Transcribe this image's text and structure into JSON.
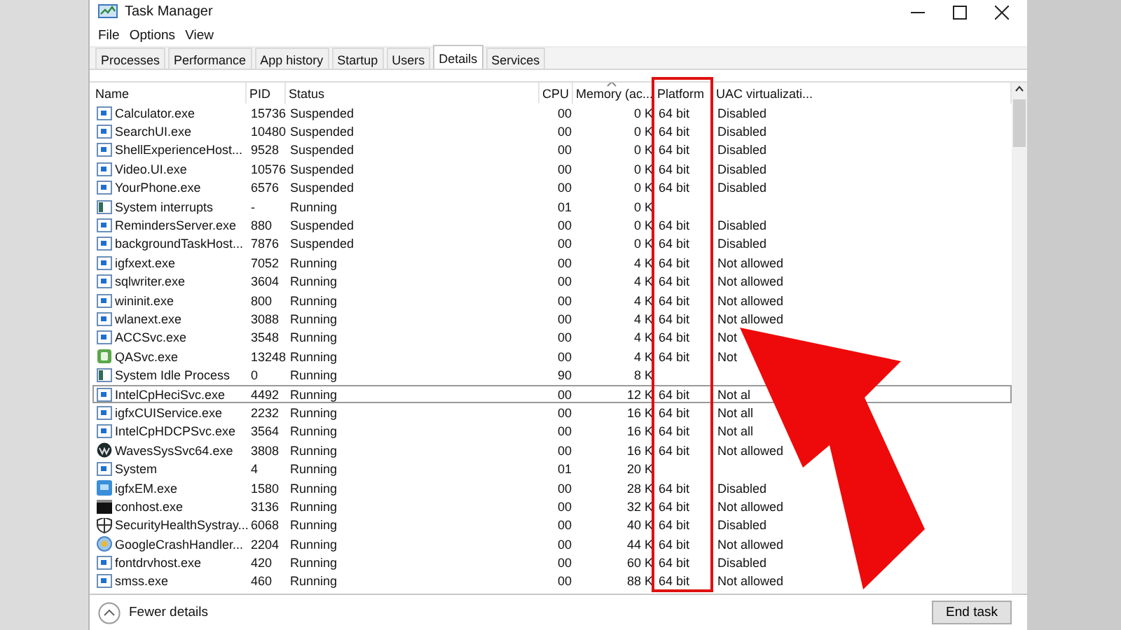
{
  "window": {
    "title": "Task Manager"
  },
  "menu": [
    "File",
    "Options",
    "View"
  ],
  "tabs": [
    {
      "label": "Processes",
      "selected": false
    },
    {
      "label": "Performance",
      "selected": false
    },
    {
      "label": "App history",
      "selected": false
    },
    {
      "label": "Startup",
      "selected": false
    },
    {
      "label": "Users",
      "selected": false
    },
    {
      "label": "Details",
      "selected": true
    },
    {
      "label": "Services",
      "selected": false
    }
  ],
  "table": {
    "columns": [
      {
        "label": "Name",
        "sorted": false
      },
      {
        "label": "PID",
        "sorted": false
      },
      {
        "label": "Status",
        "sorted": false
      },
      {
        "label": "CPU",
        "sorted": false
      },
      {
        "label": "Memory (ac...",
        "sorted": true
      },
      {
        "label": "Platform",
        "sorted": false
      },
      {
        "label": "UAC virtualizati...",
        "sorted": false
      }
    ],
    "rows": [
      {
        "kind": "app",
        "name": "Calculator.exe",
        "pid": "15736",
        "status": "Suspended",
        "cpu": "00",
        "memory": "0 K",
        "platform": "64 bit",
        "uac": "Disabled",
        "selected": false
      },
      {
        "kind": "app",
        "name": "SearchUI.exe",
        "pid": "10480",
        "status": "Suspended",
        "cpu": "00",
        "memory": "0 K",
        "platform": "64 bit",
        "uac": "Disabled",
        "selected": false
      },
      {
        "kind": "app",
        "name": "ShellExperienceHost...",
        "pid": "9528",
        "status": "Suspended",
        "cpu": "00",
        "memory": "0 K",
        "platform": "64 bit",
        "uac": "Disabled",
        "selected": false
      },
      {
        "kind": "app",
        "name": "Video.UI.exe",
        "pid": "10576",
        "status": "Suspended",
        "cpu": "00",
        "memory": "0 K",
        "platform": "64 bit",
        "uac": "Disabled",
        "selected": false
      },
      {
        "kind": "app",
        "name": "YourPhone.exe",
        "pid": "6576",
        "status": "Suspended",
        "cpu": "00",
        "memory": "0 K",
        "platform": "64 bit",
        "uac": "Disabled",
        "selected": false
      },
      {
        "kind": "system",
        "name": "System interrupts",
        "pid": "-",
        "status": "Running",
        "cpu": "01",
        "memory": "0 K",
        "selected": false
      },
      {
        "kind": "app",
        "name": "RemindersServer.exe",
        "pid": "880",
        "status": "Suspended",
        "cpu": "00",
        "memory": "0 K",
        "platform": "64 bit",
        "uac": "Disabled",
        "selected": false
      },
      {
        "kind": "app",
        "name": "backgroundTaskHost...",
        "pid": "7876",
        "status": "Suspended",
        "cpu": "00",
        "memory": "0 K",
        "platform": "64 bit",
        "uac": "Disabled",
        "selected": false
      },
      {
        "kind": "app",
        "name": "igfxext.exe",
        "pid": "7052",
        "status": "Running",
        "cpu": "00",
        "memory": "4 K",
        "platform": "64 bit",
        "uac": "Not allowed",
        "selected": false
      },
      {
        "kind": "app",
        "name": "sqlwriter.exe",
        "pid": "3604",
        "status": "Running",
        "cpu": "00",
        "memory": "4 K",
        "platform": "64 bit",
        "uac": "Not allowed",
        "selected": false
      },
      {
        "kind": "app",
        "name": "wininit.exe",
        "pid": "800",
        "status": "Running",
        "cpu": "00",
        "memory": "4 K",
        "platform": "64 bit",
        "uac": "Not allowed",
        "selected": false
      },
      {
        "kind": "app",
        "name": "wlanext.exe",
        "pid": "3088",
        "status": "Running",
        "cpu": "00",
        "memory": "4 K",
        "platform": "64 bit",
        "uac": "Not allowed",
        "selected": false
      },
      {
        "kind": "app",
        "name": "ACCSvc.exe",
        "pid": "3548",
        "status": "Running",
        "cpu": "00",
        "memory": "4 K",
        "platform": "64 bit",
        "uac": "Not",
        "selected": false
      },
      {
        "kind": "qa",
        "name": "QASvc.exe",
        "pid": "13248",
        "status": "Running",
        "cpu": "00",
        "memory": "4 K",
        "platform": "64 bit",
        "uac": "Not",
        "selected": false
      },
      {
        "kind": "system",
        "name": "System Idle Process",
        "pid": "0",
        "status": "Running",
        "cpu": "90",
        "memory": "8 K",
        "selected": false
      },
      {
        "kind": "app",
        "name": "IntelCpHeciSvc.exe",
        "pid": "4492",
        "status": "Running",
        "cpu": "00",
        "memory": "12 K",
        "platform": "64 bit",
        "uac": "Not al",
        "selected": true
      },
      {
        "kind": "app",
        "name": "igfxCUIService.exe",
        "pid": "2232",
        "status": "Running",
        "cpu": "00",
        "memory": "16 K",
        "platform": "64 bit",
        "uac": "Not all",
        "selected": false
      },
      {
        "kind": "app",
        "name": "IntelCpHDCPSvc.exe",
        "pid": "3564",
        "status": "Running",
        "cpu": "00",
        "memory": "16 K",
        "platform": "64 bit",
        "uac": "Not all",
        "selected": false
      },
      {
        "kind": "waves",
        "name": "WavesSysSvc64.exe",
        "pid": "3808",
        "status": "Running",
        "cpu": "00",
        "memory": "16 K",
        "platform": "64 bit",
        "uac": "Not allowed",
        "selected": false
      },
      {
        "kind": "app",
        "name": "System",
        "pid": "4",
        "status": "Running",
        "cpu": "01",
        "memory": "20 K",
        "selected": false
      },
      {
        "kind": "graphics",
        "name": "igfxEM.exe",
        "pid": "1580",
        "status": "Running",
        "cpu": "00",
        "memory": "28 K",
        "platform": "64 bit",
        "uac": "Disabled",
        "selected": false
      },
      {
        "kind": "console",
        "name": "conhost.exe",
        "pid": "3136",
        "status": "Running",
        "cpu": "00",
        "memory": "32 K",
        "platform": "64 bit",
        "uac": "Not allowed",
        "selected": false
      },
      {
        "kind": "shield",
        "name": "SecurityHealthSystray...",
        "pid": "6068",
        "status": "Running",
        "cpu": "00",
        "memory": "40 K",
        "platform": "64 bit",
        "uac": "Disabled",
        "selected": false
      },
      {
        "kind": "crash",
        "name": "GoogleCrashHandler...",
        "pid": "2204",
        "status": "Running",
        "cpu": "00",
        "memory": "44 K",
        "platform": "64 bit",
        "uac": "Not allowed",
        "selected": false
      },
      {
        "kind": "app",
        "name": "fontdrvhost.exe",
        "pid": "420",
        "status": "Running",
        "cpu": "00",
        "memory": "60 K",
        "platform": "64 bit",
        "uac": "Disabled",
        "selected": false
      },
      {
        "kind": "app",
        "name": "smss.exe",
        "pid": "460",
        "status": "Running",
        "cpu": "00",
        "memory": "88 K",
        "platform": "64 bit",
        "uac": "Not allowed",
        "selected": false
      }
    ]
  },
  "footer": {
    "toggle": "Fewer details",
    "button": "End task"
  }
}
